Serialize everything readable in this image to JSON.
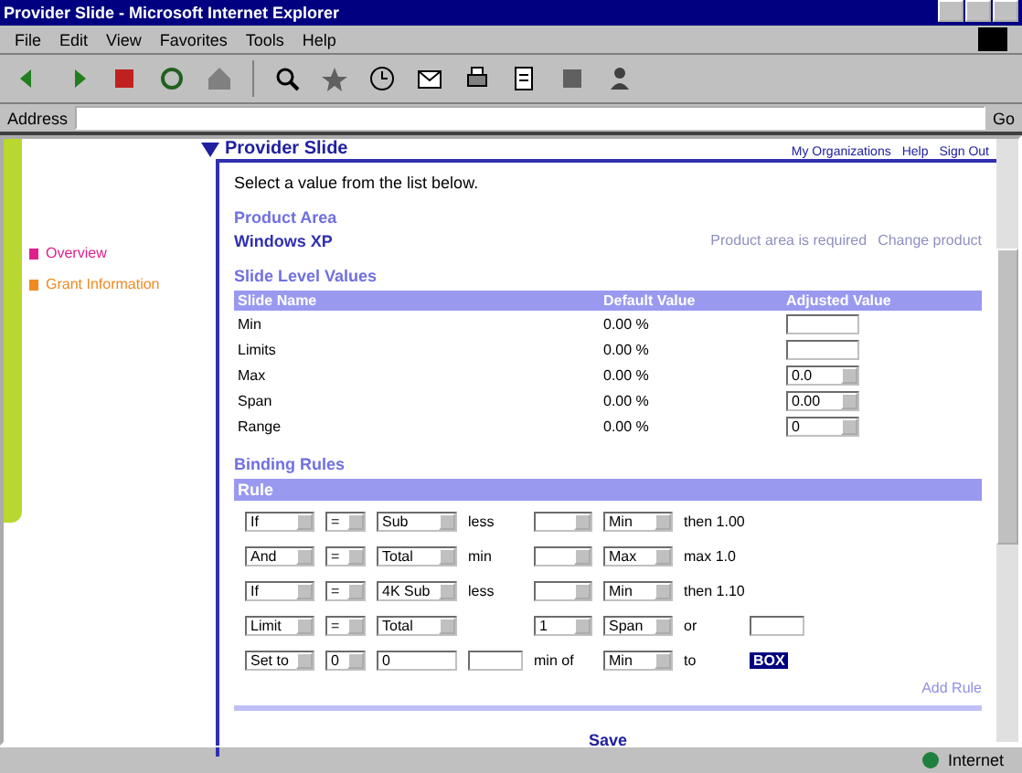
{
  "window": {
    "title": "Provider Slide - Microsoft Internet Explorer"
  },
  "menu": [
    "File",
    "Edit",
    "View",
    "Favorites",
    "Tools",
    "Help"
  ],
  "toolbar": [
    {
      "kind": "back"
    },
    {
      "kind": "forward"
    },
    {
      "kind": "stop"
    },
    {
      "kind": "refresh"
    },
    {
      "kind": "home"
    },
    {
      "kind": "search"
    },
    {
      "kind": "favorites"
    },
    {
      "kind": "history"
    },
    {
      "kind": "mail"
    },
    {
      "kind": "print"
    },
    {
      "kind": "edit"
    },
    {
      "kind": "discuss"
    },
    {
      "kind": "messenger"
    }
  ],
  "address": {
    "label": "Address",
    "go": "Go"
  },
  "sidebar": {
    "items": [
      {
        "label": "Overview",
        "color": "#e0208a"
      },
      {
        "label": "Grant Information",
        "color": "#f08a20"
      }
    ]
  },
  "page": {
    "title": "Provider Slide",
    "links": [
      "My Organizations",
      "Help",
      "Sign Out"
    ],
    "intro": "Select a value from the list below.",
    "product": {
      "heading": "Product Area",
      "value": "Windows XP",
      "note": "Product area is required",
      "link": "Change product"
    },
    "slide": {
      "heading": "Slide Level Values",
      "columns": [
        "Slide Name",
        "Default Value",
        "Adjusted Value"
      ],
      "rows": [
        {
          "name": "Min",
          "default": "0.00 %",
          "adjusted": "",
          "kind": "text"
        },
        {
          "name": "Limits",
          "default": "0.00 %",
          "adjusted": "",
          "kind": "text"
        },
        {
          "name": "Max",
          "default": "0.00 %",
          "adjusted": "0.0",
          "kind": "select"
        },
        {
          "name": "Span",
          "default": "0.00 %",
          "adjusted": "0.00",
          "kind": "select"
        },
        {
          "name": "Range",
          "default": "0.00 %",
          "adjusted": "0",
          "kind": "select"
        }
      ]
    },
    "binding": {
      "heading": "Binding Rules",
      "columns": [
        "Rule"
      ],
      "rows": [
        [
          {
            "kind": "select",
            "value": "If"
          },
          {
            "kind": "select",
            "value": "="
          },
          {
            "kind": "select",
            "value": "Sub"
          },
          {
            "kind": "label",
            "value": "less"
          },
          {
            "kind": "select"
          },
          {
            "kind": "select",
            "value": "Min"
          },
          {
            "kind": "label",
            "value": "then 1.00"
          }
        ],
        [
          {
            "kind": "select",
            "value": "And"
          },
          {
            "kind": "select",
            "value": "="
          },
          {
            "kind": "select",
            "value": "Total"
          },
          {
            "kind": "label",
            "value": "min"
          },
          {
            "kind": "select"
          },
          {
            "kind": "select",
            "value": "Max"
          },
          {
            "kind": "label",
            "value": "max 1.0"
          }
        ],
        [
          {
            "kind": "select",
            "value": "If"
          },
          {
            "kind": "select",
            "value": "="
          },
          {
            "kind": "select",
            "value": "4K Sub"
          },
          {
            "kind": "label",
            "value": "less"
          },
          {
            "kind": "select"
          },
          {
            "kind": "select",
            "value": "Min"
          },
          {
            "kind": "label",
            "value": "then 1.10"
          }
        ],
        [
          {
            "kind": "select",
            "value": "Limit"
          },
          {
            "kind": "select",
            "value": "="
          },
          {
            "kind": "select",
            "value": "Total"
          },
          {
            "kind": "label"
          },
          {
            "kind": "select",
            "value": "1"
          },
          {
            "kind": "select",
            "value": "Span"
          },
          {
            "kind": "label",
            "value": "or"
          },
          {
            "kind": "text"
          }
        ],
        [
          {
            "kind": "select",
            "value": "Set to"
          },
          {
            "kind": "select",
            "value": "0"
          },
          {
            "kind": "text",
            "value": "0"
          },
          {
            "kind": "text"
          },
          {
            "kind": "label",
            "value": "min of"
          },
          {
            "kind": "select",
            "value": "Min"
          },
          {
            "kind": "label",
            "value": "to"
          },
          {
            "kind": "badge",
            "value": "BOX"
          }
        ]
      ],
      "add": "Add Rule"
    },
    "save": "Save"
  },
  "status": {
    "zone": "Internet"
  }
}
